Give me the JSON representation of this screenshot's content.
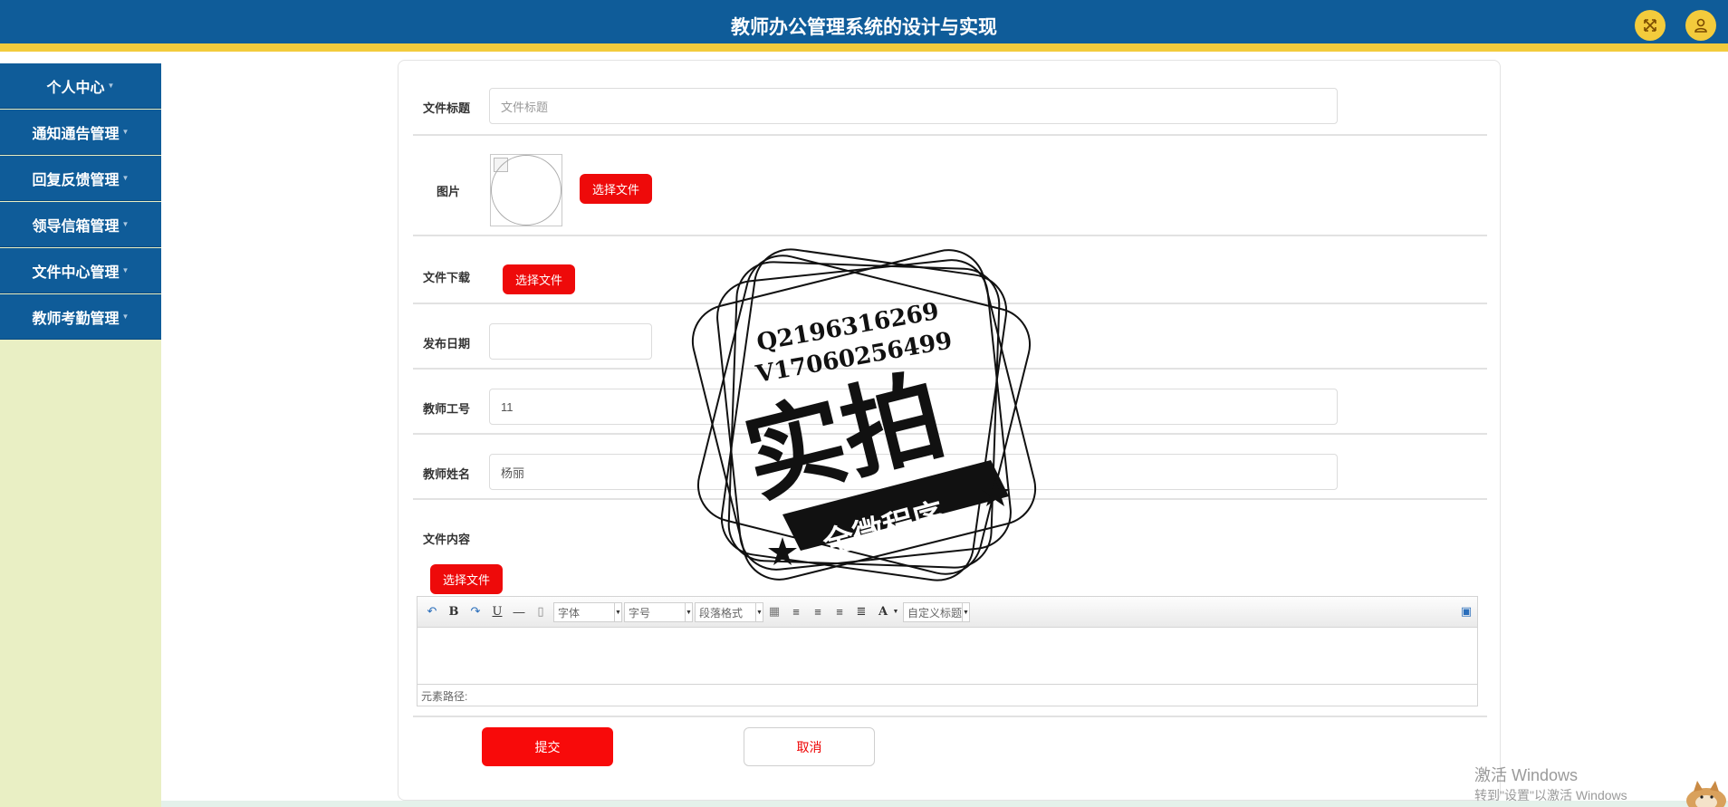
{
  "header": {
    "title": "教师办公管理系统的设计与实现"
  },
  "sidebar": {
    "items": [
      {
        "label": "个人中心"
      },
      {
        "label": "通知通告管理"
      },
      {
        "label": "回复反馈管理"
      },
      {
        "label": "领导信箱管理"
      },
      {
        "label": "文件中心管理"
      },
      {
        "label": "教师考勤管理"
      }
    ]
  },
  "form": {
    "title_label": "文件标题",
    "title_placeholder": "文件标题",
    "image_label": "图片",
    "image_button": "选择文件",
    "download_label": "文件下载",
    "download_button": "选择文件",
    "date_label": "发布日期",
    "date_value": "",
    "teacher_id_label": "教师工号",
    "teacher_id_value": "11",
    "teacher_name_label": "教师姓名",
    "teacher_name_value": "杨丽",
    "content_label": "文件内容",
    "content_button": "选择文件",
    "submit_label": "提交",
    "cancel_label": "取消"
  },
  "editor": {
    "font_select": "字体",
    "size_select": "字号",
    "paragraph_select": "段落格式",
    "custom_title_select": "自定义标题",
    "bold_glyph": "B",
    "underline_glyph": "U",
    "font_color_glyph": "A",
    "status_path": "元素路径:"
  },
  "watermark": {
    "line1": "Q2196316269",
    "line2": "V17060256499",
    "big_text": "实拍",
    "banner": "全微程序"
  },
  "os_overlay": {
    "activate_title": "激活 Windows",
    "activate_sub": "转到\"设置\"以激活 Windows"
  },
  "colors": {
    "header_bg": "#0f5c99",
    "accent_yellow": "#f3cb3c",
    "sidebar_bg": "#e9efc4",
    "primary_red": "#ee0a0a"
  }
}
